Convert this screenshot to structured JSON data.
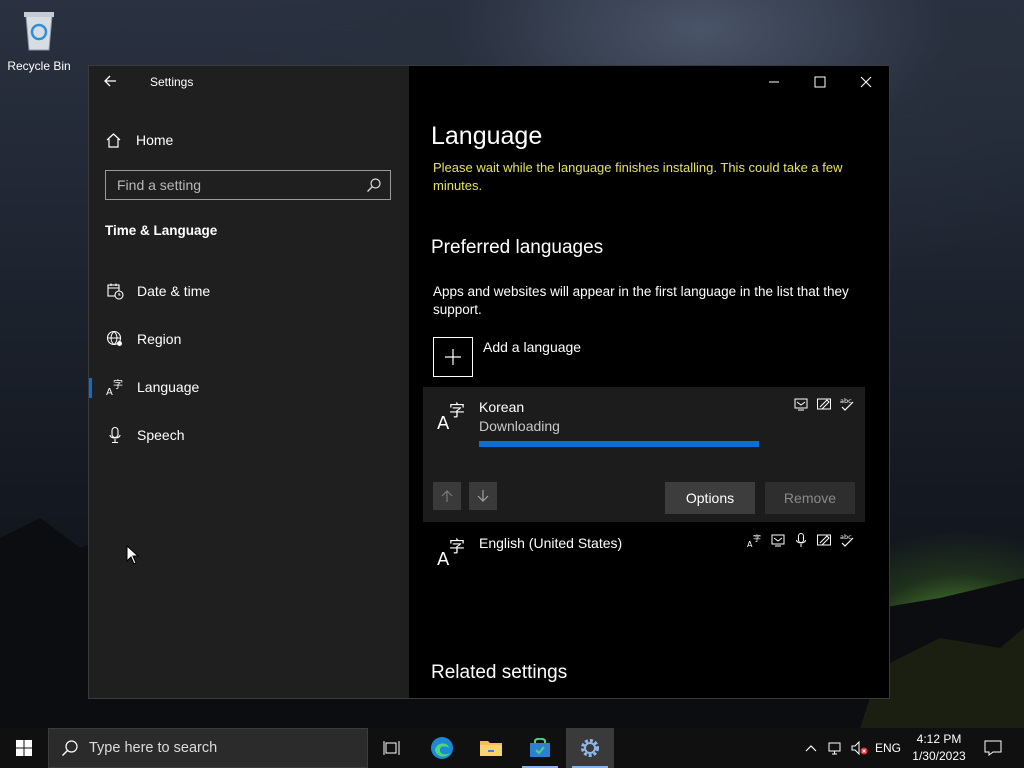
{
  "desktop": {
    "recycle_bin_label": "Recycle Bin"
  },
  "window": {
    "app_title": "Settings",
    "home_label": "Home",
    "search_placeholder": "Find a setting",
    "section_title": "Time & Language",
    "nav_items": [
      {
        "label": "Date & time",
        "icon": "calendar-clock-icon"
      },
      {
        "label": "Region",
        "icon": "globe-icon"
      },
      {
        "label": "Language",
        "icon": "language-icon",
        "active": true
      },
      {
        "label": "Speech",
        "icon": "microphone-icon"
      }
    ]
  },
  "main": {
    "page_title": "Language",
    "notice": "Please wait while the language finishes installing. This could take a few minutes.",
    "preferred_heading": "Preferred languages",
    "description": "Apps and websites will appear in the first language in the list that they support.",
    "add_language_label": "Add a language",
    "languages": [
      {
        "name": "Korean",
        "status": "Downloading",
        "progress": 1.0,
        "features": [
          "display-language-icon",
          "handwriting-icon",
          "spell-check-icon"
        ]
      },
      {
        "name": "English (United States)",
        "status": "",
        "features": [
          "language-pack-icon",
          "display-language-icon",
          "speech-icon",
          "handwriting-icon",
          "spell-check-icon"
        ]
      }
    ],
    "options_label": "Options",
    "remove_label": "Remove",
    "related_heading": "Related settings"
  },
  "taskbar": {
    "search_placeholder": "Type here to search",
    "input_indicator": "ENG",
    "time": "4:12 PM",
    "date": "1/30/2023"
  },
  "colors": {
    "accent": "#0a6fd1",
    "notice": "#e6e35a"
  }
}
